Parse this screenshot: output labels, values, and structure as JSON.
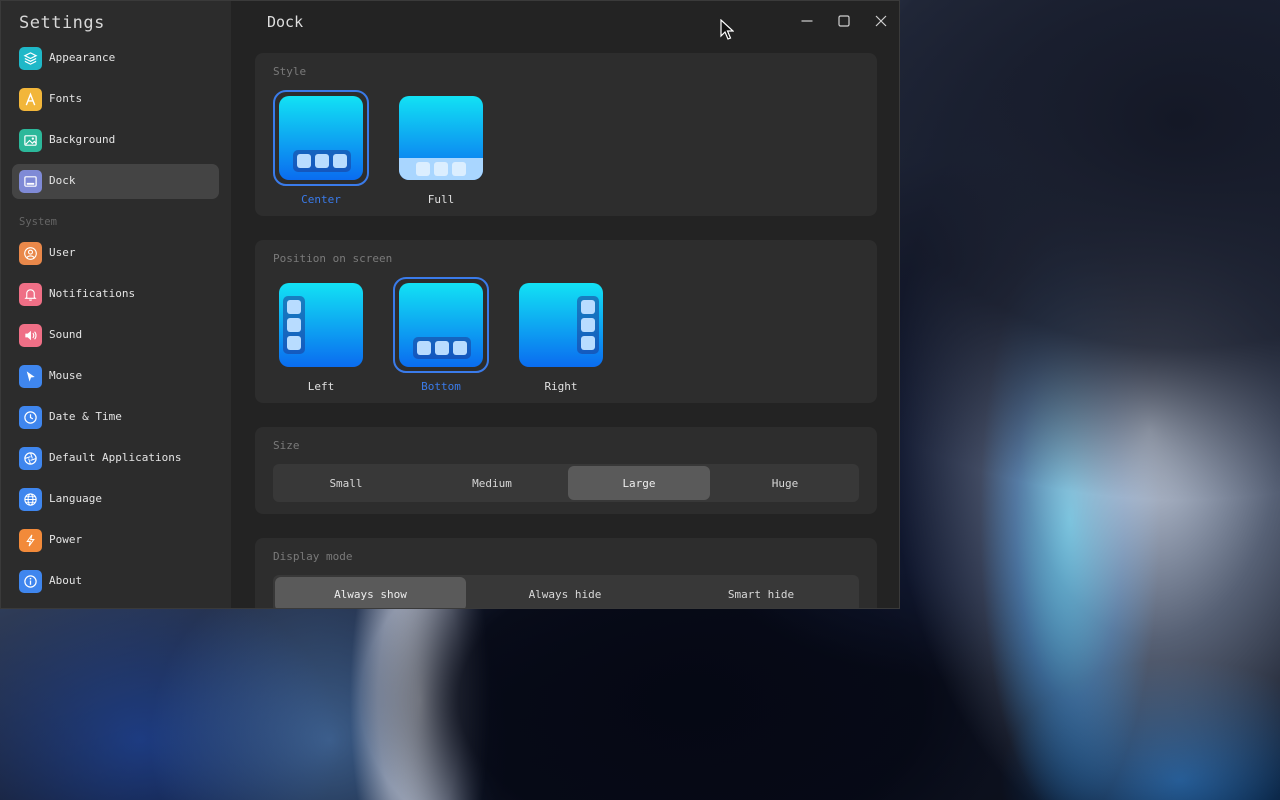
{
  "window": {
    "app_title": "Settings",
    "page_title": "Dock"
  },
  "sidebar": {
    "items_top": [
      {
        "label": "Appearance",
        "icon": "layers-icon",
        "color": "#1fb8c8"
      },
      {
        "label": "Fonts",
        "icon": "font-icon",
        "color": "#f2b63a"
      },
      {
        "label": "Background",
        "icon": "image-icon",
        "color": "#2cb89a"
      },
      {
        "label": "Dock",
        "icon": "dock-icon",
        "color": "#7f8ad6",
        "active": true
      }
    ],
    "section_label": "System",
    "items_system": [
      {
        "label": "User",
        "icon": "user-icon",
        "color": "#e9884a"
      },
      {
        "label": "Notifications",
        "icon": "bell-icon",
        "color": "#ef6f86"
      },
      {
        "label": "Sound",
        "icon": "speaker-icon",
        "color": "#ef6f86"
      },
      {
        "label": "Mouse",
        "icon": "pointer-icon",
        "color": "#3f86ee"
      },
      {
        "label": "Date & Time",
        "icon": "clock-icon",
        "color": "#3f86ee"
      },
      {
        "label": "Default Applications",
        "icon": "aperture-icon",
        "color": "#3f86ee"
      },
      {
        "label": "Language",
        "icon": "globe-icon",
        "color": "#3f86ee"
      },
      {
        "label": "Power",
        "icon": "bolt-icon",
        "color": "#f28a3a"
      },
      {
        "label": "About",
        "icon": "info-icon",
        "color": "#3f86ee"
      }
    ]
  },
  "style": {
    "title": "Style",
    "options": [
      {
        "label": "Center",
        "selected": true
      },
      {
        "label": "Full",
        "selected": false
      }
    ]
  },
  "position": {
    "title": "Position on screen",
    "options": [
      {
        "label": "Left",
        "selected": false
      },
      {
        "label": "Bottom",
        "selected": true
      },
      {
        "label": "Right",
        "selected": false
      }
    ]
  },
  "size": {
    "title": "Size",
    "options": [
      "Small",
      "Medium",
      "Large",
      "Huge"
    ],
    "selected": "Large"
  },
  "display_mode": {
    "title": "Display mode",
    "options": [
      "Always show",
      "Always hide",
      "Smart hide"
    ],
    "selected": "Always show"
  },
  "colors": {
    "accent": "#3a7bea",
    "window_bg": "#232323",
    "sidebar_bg": "#2c2c2c",
    "card_bg": "#2d2d2d"
  }
}
